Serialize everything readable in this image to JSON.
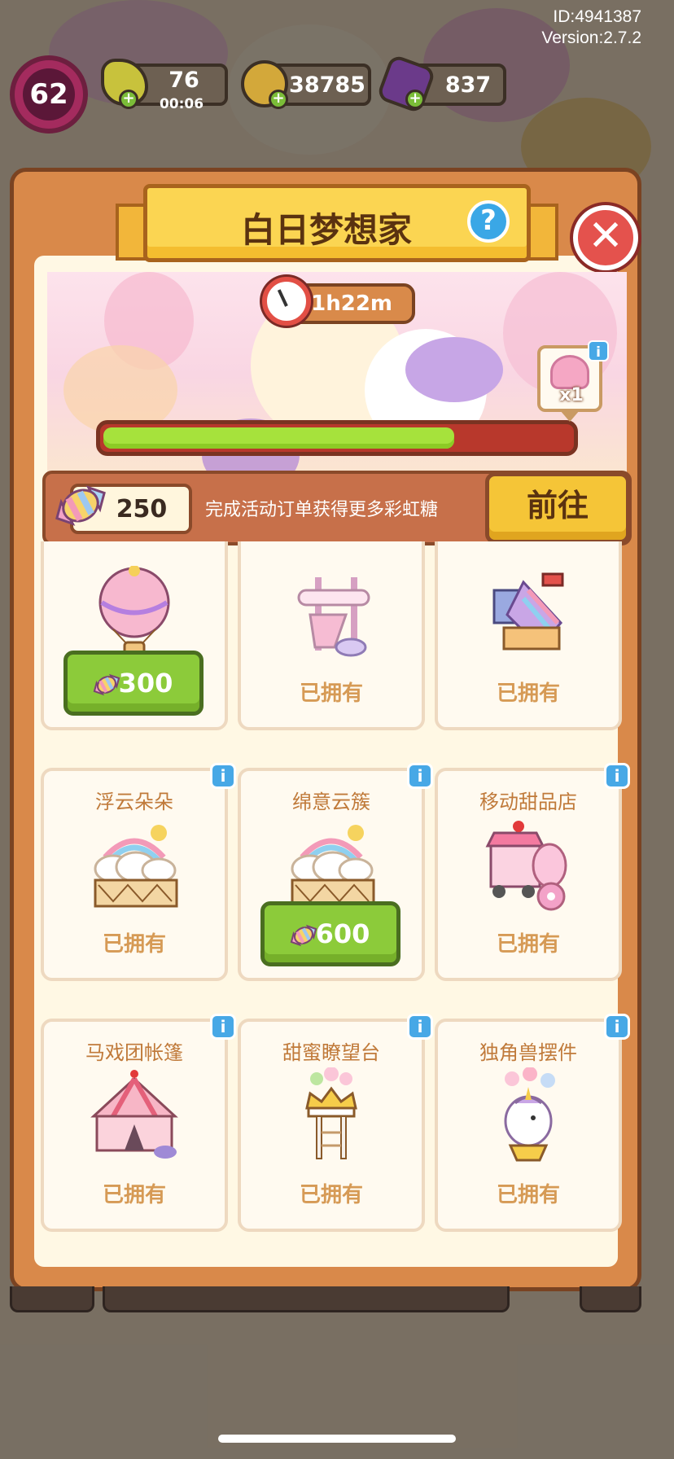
{
  "header": {
    "id_text": "ID:4941387",
    "version_text": "Version:2.7.2"
  },
  "hud": {
    "level": "62",
    "energy": "76",
    "energy_timer": "00:06",
    "coins": "38785",
    "gems": "837"
  },
  "event": {
    "title": "白日梦想家",
    "timer": "1h22m",
    "progress": 0.74,
    "reward_count": "x1",
    "candy_count": "250",
    "candy_desc": "完成活动订单获得更多彩虹糖",
    "go_label": "前往"
  },
  "items": [
    {
      "name": "",
      "owned": "",
      "price": "300",
      "info": false,
      "art": "balloon"
    },
    {
      "name": "",
      "owned": "已拥有",
      "price": null,
      "info": false,
      "art": "cotton"
    },
    {
      "name": "",
      "owned": "已拥有",
      "price": null,
      "info": false,
      "art": "rainbow-machine"
    },
    {
      "name": "浮云朵朵",
      "owned": "已拥有",
      "price": null,
      "info": true,
      "art": "cloud-fence"
    },
    {
      "name": "绵意云簇",
      "owned": "",
      "price": "600",
      "info": true,
      "art": "cloud-fence"
    },
    {
      "name": "移动甜品店",
      "owned": "已拥有",
      "price": null,
      "info": true,
      "art": "dessert-cart"
    },
    {
      "name": "马戏团帐篷",
      "owned": "已拥有",
      "price": null,
      "info": true,
      "art": "tent"
    },
    {
      "name": "甜蜜瞭望台",
      "owned": "已拥有",
      "price": null,
      "info": true,
      "art": "tower"
    },
    {
      "name": "独角兽摆件",
      "owned": "已拥有",
      "price": null,
      "info": true,
      "art": "unicorn"
    }
  ],
  "colors": {
    "panel": "#d9894a",
    "ribbon": "#fbd552",
    "progress_fill": "#a6e23c",
    "price_button": "#8ccb3a",
    "info_button": "#47a8e6",
    "close_button": "#e4524d"
  }
}
